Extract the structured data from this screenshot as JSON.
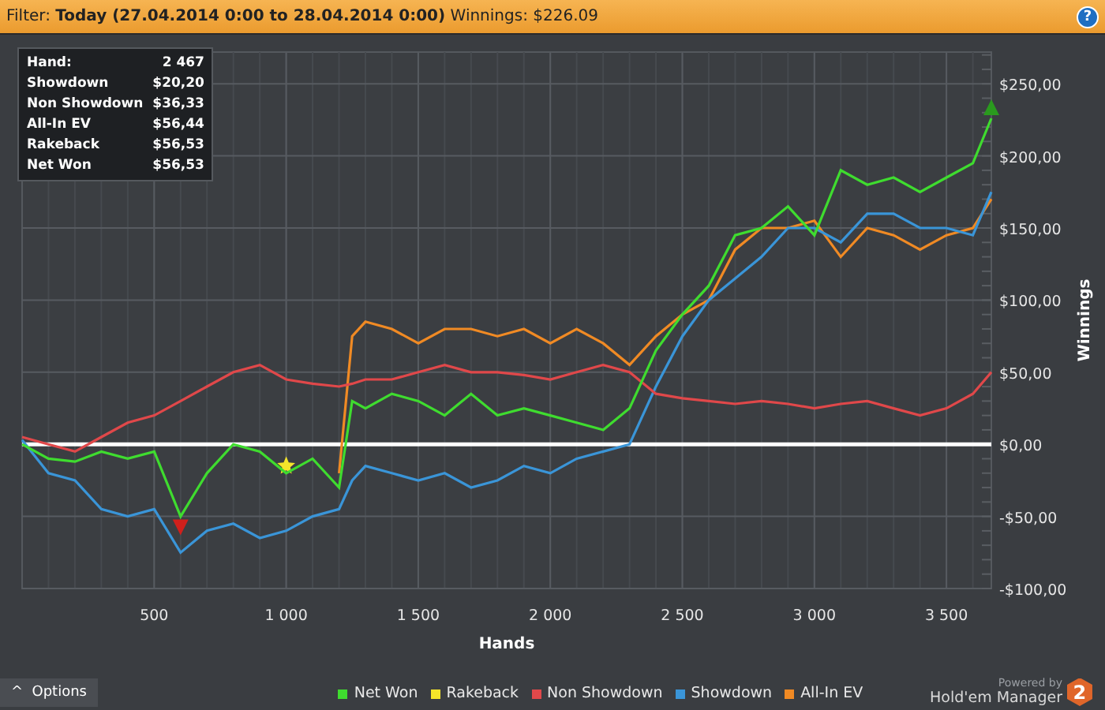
{
  "filter_bar": {
    "text": "Filter: **Today (27.04.2014 0:00 to 28.04.2014 0:00)** Winnings: $226.09",
    "help": "?"
  },
  "stats": [
    {
      "label": "Hand:",
      "value": "2 467"
    },
    {
      "label": "Showdown",
      "value": "$20,20"
    },
    {
      "label": "Non Showdown",
      "value": "$36,33"
    },
    {
      "label": "All-In EV",
      "value": "$56,44"
    },
    {
      "label": "Rakeback",
      "value": "$56,53"
    },
    {
      "label": "Net Won",
      "value": "$56,53"
    }
  ],
  "chart_data": {
    "type": "line",
    "xlabel": "Hands",
    "ylabel": "Winnings",
    "xlim": [
      0,
      3670
    ],
    "ylim": [
      -100,
      272
    ],
    "x": [
      0,
      100,
      200,
      300,
      400,
      500,
      600,
      700,
      800,
      900,
      1000,
      1100,
      1200,
      1250,
      1300,
      1400,
      1500,
      1600,
      1700,
      1800,
      1900,
      2000,
      2100,
      2200,
      2300,
      2400,
      2500,
      2600,
      2700,
      2800,
      2900,
      3000,
      3100,
      3200,
      3300,
      3400,
      3500,
      3600,
      3670
    ],
    "xticks": [
      {
        "value": 500,
        "label": "500"
      },
      {
        "value": 1000,
        "label": "1 000"
      },
      {
        "value": 1500,
        "label": "1 500"
      },
      {
        "value": 2000,
        "label": "2 000"
      },
      {
        "value": 2500,
        "label": "2 500"
      },
      {
        "value": 3000,
        "label": "3 000"
      },
      {
        "value": 3500,
        "label": "3 500"
      }
    ],
    "yticks": [
      {
        "value": -100,
        "label": "-$100,00"
      },
      {
        "value": -50,
        "label": "-$50,00"
      },
      {
        "value": 0,
        "label": "$0,00"
      },
      {
        "value": 50,
        "label": "$50,00"
      },
      {
        "value": 100,
        "label": "$100,00"
      },
      {
        "value": 150,
        "label": "$150,00"
      },
      {
        "value": 200,
        "label": "$200,00"
      },
      {
        "value": 250,
        "label": "$250,00"
      }
    ],
    "grid": true,
    "series": [
      {
        "name": "Net Won",
        "color": "#3fdc2f",
        "values": [
          0,
          -10,
          -12,
          -5,
          -10,
          -5,
          -50,
          -20,
          0,
          -5,
          -20,
          -10,
          -30,
          30,
          25,
          35,
          30,
          20,
          35,
          20,
          25,
          20,
          15,
          10,
          25,
          65,
          90,
          110,
          145,
          150,
          165,
          145,
          190,
          180,
          185,
          175,
          185,
          195,
          226
        ]
      },
      {
        "name": "Rakeback",
        "color": "#f5e52a",
        "marker": "star",
        "values": [
          null,
          null,
          null,
          null,
          null,
          null,
          null,
          null,
          null,
          null,
          -15,
          null,
          null,
          null,
          null,
          null,
          null,
          null,
          null,
          null,
          null,
          null,
          null,
          null,
          null,
          null,
          null,
          null,
          null,
          null,
          null,
          null,
          null,
          null,
          null,
          null,
          null,
          null,
          null
        ]
      },
      {
        "name": "Non Showdown",
        "color": "#e0484a",
        "values": [
          5,
          0,
          -5,
          5,
          15,
          20,
          30,
          40,
          50,
          55,
          45,
          42,
          40,
          42,
          45,
          45,
          50,
          55,
          50,
          50,
          48,
          45,
          50,
          55,
          50,
          35,
          32,
          30,
          28,
          30,
          28,
          25,
          28,
          30,
          25,
          20,
          25,
          35,
          50
        ]
      },
      {
        "name": "Showdown",
        "color": "#3a95d8",
        "values": [
          3,
          -20,
          -25,
          -45,
          -50,
          -45,
          -75,
          -60,
          -55,
          -65,
          -60,
          -50,
          -45,
          -25,
          -15,
          -20,
          -25,
          -20,
          -30,
          -25,
          -15,
          -20,
          -10,
          -5,
          0,
          40,
          75,
          100,
          115,
          130,
          150,
          150,
          140,
          160,
          160,
          150,
          150,
          145,
          175
        ]
      },
      {
        "name": "All-In EV",
        "color": "#f08a24",
        "values": [
          null,
          null,
          null,
          null,
          null,
          null,
          null,
          null,
          null,
          null,
          null,
          null,
          -20,
          75,
          85,
          80,
          70,
          80,
          80,
          75,
          80,
          70,
          80,
          70,
          55,
          75,
          90,
          100,
          135,
          150,
          150,
          155,
          130,
          150,
          145,
          135,
          145,
          150,
          170
        ]
      }
    ]
  },
  "options_button": {
    "label": "Options",
    "icon": "^"
  },
  "branding": {
    "powered": "Powered by",
    "name": "Hold'em Manager",
    "badge": "2"
  }
}
